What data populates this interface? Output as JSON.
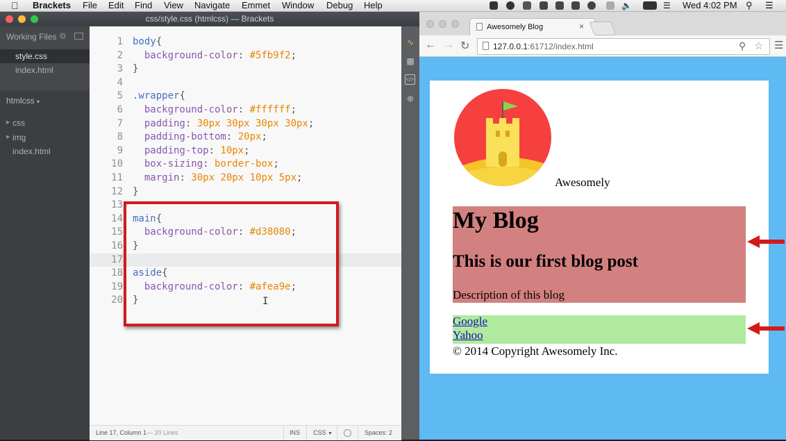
{
  "menubar": {
    "app": "Brackets",
    "items": [
      "File",
      "Edit",
      "Find",
      "View",
      "Navigate",
      "Emmet",
      "Window",
      "Debug",
      "Help"
    ],
    "clock": "Wed 4:02 PM"
  },
  "window": {
    "title": "css/style.css (htmlcss) — Brackets"
  },
  "sidebar": {
    "working_files_header": "Working Files",
    "working_files": [
      "style.css",
      "index.html"
    ],
    "project": "htmlcss",
    "tree": [
      "css",
      "img",
      "index.html"
    ]
  },
  "editor": {
    "current_line": 17,
    "lines": [
      {
        "n": "1",
        "tokens": [
          [
            "tok-selector",
            "body"
          ],
          [
            "tok-brace",
            "{"
          ]
        ]
      },
      {
        "n": "2",
        "tokens": [
          [
            "tok-prop",
            "  background-color"
          ],
          [
            "tok-punct",
            ": "
          ],
          [
            "tok-value",
            "#5fb9f2"
          ],
          [
            "tok-punct",
            ";"
          ]
        ]
      },
      {
        "n": "3",
        "tokens": [
          [
            "tok-brace",
            "}"
          ]
        ]
      },
      {
        "n": "4",
        "tokens": []
      },
      {
        "n": "5",
        "tokens": [
          [
            "tok-selector",
            ".wrapper"
          ],
          [
            "tok-brace",
            "{"
          ]
        ]
      },
      {
        "n": "6",
        "tokens": [
          [
            "tok-prop",
            "  background-color"
          ],
          [
            "tok-punct",
            ": "
          ],
          [
            "tok-value",
            "#ffffff"
          ],
          [
            "tok-punct",
            ";"
          ]
        ]
      },
      {
        "n": "7",
        "tokens": [
          [
            "tok-prop",
            "  padding"
          ],
          [
            "tok-punct",
            ": "
          ],
          [
            "tok-value",
            "30px 30px 30px 30px"
          ],
          [
            "tok-punct",
            ";"
          ]
        ]
      },
      {
        "n": "8",
        "tokens": [
          [
            "tok-prop",
            "  padding-bottom"
          ],
          [
            "tok-punct",
            ": "
          ],
          [
            "tok-value",
            "20px"
          ],
          [
            "tok-punct",
            ";"
          ]
        ]
      },
      {
        "n": "9",
        "tokens": [
          [
            "tok-prop",
            "  padding-top"
          ],
          [
            "tok-punct",
            ": "
          ],
          [
            "tok-value",
            "10px"
          ],
          [
            "tok-punct",
            ";"
          ]
        ]
      },
      {
        "n": "10",
        "tokens": [
          [
            "tok-prop",
            "  box-sizing"
          ],
          [
            "tok-punct",
            ": "
          ],
          [
            "tok-value",
            "border-box"
          ],
          [
            "tok-punct",
            ";"
          ]
        ]
      },
      {
        "n": "11",
        "tokens": [
          [
            "tok-prop",
            "  margin"
          ],
          [
            "tok-punct",
            ": "
          ],
          [
            "tok-value",
            "30px 20px 10px 5px"
          ],
          [
            "tok-punct",
            ";"
          ]
        ]
      },
      {
        "n": "12",
        "tokens": [
          [
            "tok-brace",
            "}"
          ]
        ]
      },
      {
        "n": "13",
        "tokens": []
      },
      {
        "n": "14",
        "tokens": [
          [
            "tok-selector",
            "main"
          ],
          [
            "tok-brace",
            "{"
          ]
        ]
      },
      {
        "n": "15",
        "tokens": [
          [
            "tok-prop",
            "  background-color"
          ],
          [
            "tok-punct",
            ": "
          ],
          [
            "tok-value",
            "#d38080"
          ],
          [
            "tok-punct",
            ";"
          ]
        ]
      },
      {
        "n": "16",
        "tokens": [
          [
            "tok-brace",
            "}"
          ]
        ]
      },
      {
        "n": "17",
        "tokens": []
      },
      {
        "n": "18",
        "tokens": [
          [
            "tok-selector",
            "aside"
          ],
          [
            "tok-brace",
            "{"
          ]
        ]
      },
      {
        "n": "19",
        "tokens": [
          [
            "tok-prop",
            "  background-color"
          ],
          [
            "tok-punct",
            ": "
          ],
          [
            "tok-value",
            "#afea9e"
          ],
          [
            "tok-punct",
            ";"
          ]
        ]
      },
      {
        "n": "20",
        "tokens": [
          [
            "tok-brace",
            "}"
          ]
        ]
      }
    ]
  },
  "statusbar": {
    "position": "Line 17, Column 1",
    "lines": "— 20 Lines",
    "mode": "INS",
    "language": "CSS",
    "spaces": "Spaces: 2"
  },
  "browser": {
    "tab_title": "Awesomely Blog",
    "url_host": "127.0.0.1",
    "url_path": ":61712/index.html"
  },
  "page": {
    "logo_text": "Awesomely",
    "main_title": "My Blog",
    "post_title": "This is our first blog post",
    "post_desc": "Description of this blog",
    "links": [
      "Google",
      "Yahoo"
    ],
    "copyright": "© 2014 Copyright Awesomely Inc."
  },
  "colors": {
    "body_bg": "#5fb9f2",
    "wrapper_bg": "#ffffff",
    "main_bg": "#d38080",
    "aside_bg": "#afea9e",
    "annotation_red": "#d21a1a"
  }
}
